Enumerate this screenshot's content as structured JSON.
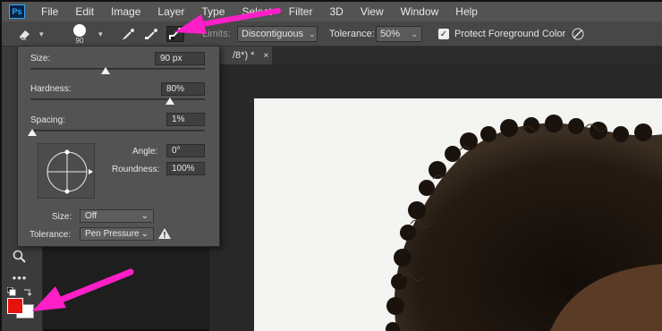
{
  "app": {
    "logo": "Ps"
  },
  "menu": [
    "File",
    "Edit",
    "Image",
    "Layer",
    "Type",
    "Select",
    "Filter",
    "3D",
    "View",
    "Window",
    "Help"
  ],
  "options_bar": {
    "brush_size": "90",
    "limits_label": "Limits:",
    "limits_value": "Discontiguous",
    "tolerance_label": "Tolerance:",
    "tolerance_value": "50%",
    "protect_label": "Protect Foreground Color",
    "protect_checked": "✓"
  },
  "document_tab": {
    "title": "/8*) *",
    "close": "×"
  },
  "brush_popover": {
    "size_label": "Size:",
    "size_value": "90 px",
    "hardness_label": "Hardness:",
    "hardness_value": "80%",
    "spacing_label": "Spacing:",
    "spacing_value": "1%",
    "angle_label": "Angle:",
    "angle_value": "0°",
    "roundness_label": "Roundness:",
    "roundness_value": "100%",
    "size_control_label": "Size:",
    "size_control_value": "Off",
    "tolerance_label": "Tolerance:",
    "tolerance_value": "Pen Pressure",
    "size_fraction": 0.43,
    "hardness_fraction": 0.8,
    "spacing_fraction": 0.01
  },
  "colors": {
    "foreground": "#e8120c",
    "background": "#ffffff",
    "annotation_arrow": "#ff1fc8",
    "accent": "#31a8ff"
  },
  "icons": {
    "eraser_tool": "eraser-icon",
    "brush_preset": "brush-preset-icon",
    "sampling_continuous": "eyedropper-continuous-icon",
    "sampling_once": "eyedropper-once-icon",
    "sampling_background_swatch": "eyedropper-background-swatch-icon",
    "pressure": "pressure-icon",
    "zoom": "magnifier-icon",
    "more": "more-icon"
  }
}
